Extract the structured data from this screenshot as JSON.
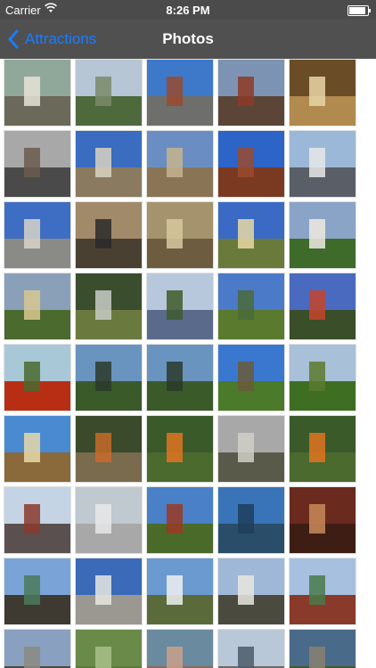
{
  "status": {
    "carrier": "Carrier",
    "time": "8:26 PM"
  },
  "nav": {
    "back_label": "Attractions",
    "title": "Photos"
  },
  "colors": {
    "accent": "#1a7cff",
    "navbar": "#505050"
  },
  "thumbnails": [
    {
      "sky": "#8fa89a",
      "ground": "#6b6a5a",
      "shape": "#e6e2d6"
    },
    {
      "sky": "#b7c6d4",
      "ground": "#4e6a3c",
      "shape": "#7a8a6a"
    },
    {
      "sky": "#3e78c8",
      "ground": "#6e6e6a",
      "shape": "#9a4a2e"
    },
    {
      "sky": "#7d93b4",
      "ground": "#5a4536",
      "shape": "#8e3a26"
    },
    {
      "sky": "#6a4d26",
      "ground": "#b08a4e",
      "shape": "#e8d6a8"
    },
    {
      "sky": "#a8a8a8",
      "ground": "#4a4a4a",
      "shape": "#6a5a4e"
    },
    {
      "sky": "#3a6cc0",
      "ground": "#8a7a60",
      "shape": "#d9d2c2"
    },
    {
      "sky": "#6a8ec4",
      "ground": "#8a7456",
      "shape": "#c4b48e"
    },
    {
      "sky": "#2c64c8",
      "ground": "#7a3a22",
      "shape": "#9a4a2e"
    },
    {
      "sky": "#9cb8d8",
      "ground": "#5a5e66",
      "shape": "#e8e8e8"
    },
    {
      "sky": "#3e6ec4",
      "ground": "#8a8a86",
      "shape": "#d8d4c8"
    },
    {
      "sky": "#a08a6a",
      "ground": "#4a4032",
      "shape": "#2a2a2a"
    },
    {
      "sky": "#a4936c",
      "ground": "#6e5c40",
      "shape": "#d8c8a0"
    },
    {
      "sky": "#3a6ac4",
      "ground": "#6a7a3a",
      "shape": "#e8d8a2"
    },
    {
      "sky": "#8aa4c8",
      "ground": "#3e6a2a",
      "shape": "#efeae0"
    },
    {
      "sky": "#8aa0b8",
      "ground": "#4a6a2e",
      "shape": "#d8c890"
    },
    {
      "sky": "#3a4e2e",
      "ground": "#6a7a3e",
      "shape": "#c8ccc4"
    },
    {
      "sky": "#b8c8dc",
      "ground": "#5a6a8a",
      "shape": "#3e5a2a"
    },
    {
      "sky": "#4a7ac8",
      "ground": "#5a7a2e",
      "shape": "#4a6a3a"
    },
    {
      "sky": "#4a6ac0",
      "ground": "#3a4e2a",
      "shape": "#c4442a"
    },
    {
      "sky": "#a8c8d8",
      "ground": "#b82e14",
      "shape": "#4a6a2e"
    },
    {
      "sky": "#6a94c0",
      "ground": "#3a5a2a",
      "shape": "#2a3a2a"
    },
    {
      "sky": "#6a94c0",
      "ground": "#3a5a2a",
      "shape": "#2a3a2a"
    },
    {
      "sky": "#3a78d0",
      "ground": "#4a7a2a",
      "shape": "#6a5a3a"
    },
    {
      "sky": "#a8c0d8",
      "ground": "#3e6e22",
      "shape": "#5a7a2e"
    },
    {
      "sky": "#4a8ad0",
      "ground": "#8a6a3a",
      "shape": "#e8d8a8"
    },
    {
      "sky": "#3a4a2a",
      "ground": "#7a6a4e",
      "shape": "#c86a2a"
    },
    {
      "sky": "#3a5a2a",
      "ground": "#4a6a2e",
      "shape": "#e07420"
    },
    {
      "sky": "#a8a8a8",
      "ground": "#5a5a4a",
      "shape": "#d0d0c8"
    },
    {
      "sky": "#3a5a2a",
      "ground": "#4a6a2e",
      "shape": "#e07420"
    },
    {
      "sky": "#c4d4e4",
      "ground": "#5a5050",
      "shape": "#8a3a2a"
    },
    {
      "sky": "#c0c8d0",
      "ground": "#a8a8a8",
      "shape": "#e8e8e8"
    },
    {
      "sky": "#4a80c8",
      "ground": "#4a6a2a",
      "shape": "#9a3a22"
    },
    {
      "sky": "#3a74b8",
      "ground": "#2a4e6a",
      "shape": "#1e3e5a"
    },
    {
      "sky": "#6a2a1e",
      "ground": "#3e1e14",
      "shape": "#c88a5a"
    },
    {
      "sky": "#7aa4d8",
      "ground": "#3e3a32",
      "shape": "#4a7a5a"
    },
    {
      "sky": "#3a6ab8",
      "ground": "#9a9890",
      "shape": "#e8e6e0"
    },
    {
      "sky": "#6a9ad0",
      "ground": "#5a6a3a",
      "shape": "#f0f0f0"
    },
    {
      "sky": "#a0b8d8",
      "ground": "#4a4a3e",
      "shape": "#e8e6e0"
    },
    {
      "sky": "#a8c0e0",
      "ground": "#8a3a2a",
      "shape": "#4a7a4a"
    },
    {
      "sky": "#8aa0c0",
      "ground": "#4a4a40",
      "shape": "#8a8a80"
    },
    {
      "sky": "#6a8a4a",
      "ground": "#5a7a3a",
      "shape": "#a8c08a"
    },
    {
      "sky": "#6a8aa0",
      "ground": "#8a6a5a",
      "shape": "#c8a08a"
    },
    {
      "sky": "#b8c8d8",
      "ground": "#6a6a6a",
      "shape": "#4a5a6a"
    },
    {
      "sky": "#4a6a8a",
      "ground": "#3e5a2a",
      "shape": "#8a8070"
    }
  ]
}
